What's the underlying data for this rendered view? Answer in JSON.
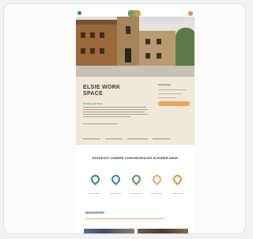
{
  "page": {
    "hero_title": "ELSIE WORK SPACE",
    "hero_subtitle": "Erstellt jetzt Ihren",
    "form_label": "Coworking",
    "cta_label": "",
    "section_title": "ENTDECKT UNSERE COWORKSPACES IN EURER NÄHE",
    "news_title": "NEUIGKEITEN"
  },
  "colors": {
    "accent_green": "#4b9a59",
    "accent_orange": "#f08b2e",
    "accent_teal": "#2d8a8f",
    "intro_bg": "#efe7d7"
  },
  "locations": [
    {
      "icon": "map-pin-icon",
      "color": "#2d8a8f"
    },
    {
      "icon": "map-pin-icon",
      "color": "#2d8a8f"
    },
    {
      "icon": "map-pin-icon",
      "color": "#4b9a59"
    },
    {
      "icon": "map-pin-icon",
      "color": "#f0a45a"
    },
    {
      "icon": "map-pin-icon",
      "color": "#f08b2e"
    }
  ]
}
